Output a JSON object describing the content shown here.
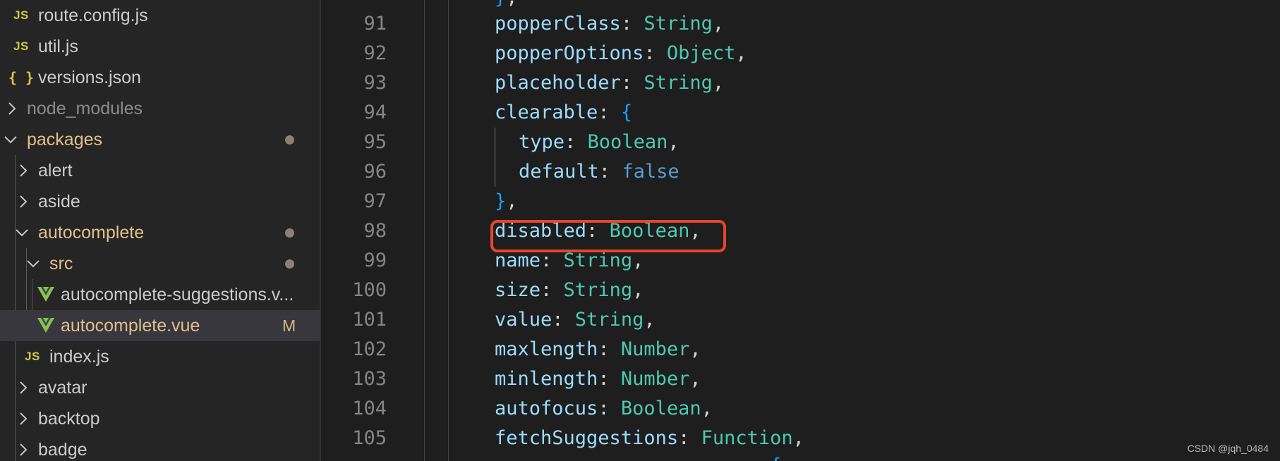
{
  "explorer": {
    "items": [
      {
        "label": "route.config.js",
        "icon": "js-file-icon",
        "icon_text": "JS"
      },
      {
        "label": "util.js",
        "icon": "js-file-icon",
        "icon_text": "JS"
      },
      {
        "label": "versions.json",
        "icon": "json-file-icon",
        "icon_text": "{ }"
      },
      {
        "label": "node_modules",
        "icon": "chevron-right-icon"
      },
      {
        "label": "packages",
        "icon": "chevron-down-icon",
        "modified_dot": true
      },
      {
        "label": "alert",
        "icon": "chevron-right-icon"
      },
      {
        "label": "aside",
        "icon": "chevron-right-icon"
      },
      {
        "label": "autocomplete",
        "icon": "chevron-down-icon",
        "modified_dot": true
      },
      {
        "label": "src",
        "icon": "chevron-down-icon",
        "modified_dot": true
      },
      {
        "label": "autocomplete-suggestions.v...",
        "icon": "vue-file-icon"
      },
      {
        "label": "autocomplete.vue",
        "icon": "vue-file-icon",
        "selected": true,
        "git_status": "M"
      },
      {
        "label": "index.js",
        "icon": "js-file-icon",
        "icon_text": "JS"
      },
      {
        "label": "avatar",
        "icon": "chevron-right-icon"
      },
      {
        "label": "backtop",
        "icon": "chevron-right-icon"
      },
      {
        "label": "badge",
        "icon": "chevron-right-icon"
      }
    ]
  },
  "editor": {
    "lines": [
      {
        "num": "91",
        "key": "popperClass",
        "type": "String",
        "suffix": ","
      },
      {
        "num": "92",
        "key": "popperOptions",
        "type": "Object",
        "suffix": ","
      },
      {
        "num": "93",
        "key": "placeholder",
        "type": "String",
        "suffix": ","
      },
      {
        "num": "94",
        "key": "clearable",
        "open": "{"
      },
      {
        "num": "95",
        "key": "type",
        "type": "Boolean",
        "suffix": ","
      },
      {
        "num": "96",
        "key": "default",
        "literal": "false"
      },
      {
        "num": "97",
        "close": "}",
        "suffix": ","
      },
      {
        "num": "98",
        "key": "disabled",
        "type": "Boolean",
        "suffix": ","
      },
      {
        "num": "99",
        "key": "name",
        "type": "String",
        "suffix": ","
      },
      {
        "num": "100",
        "key": "size",
        "type": "String",
        "suffix": ","
      },
      {
        "num": "101",
        "key": "value",
        "type": "String",
        "suffix": ","
      },
      {
        "num": "102",
        "key": "maxlength",
        "type": "Number",
        "suffix": ","
      },
      {
        "num": "103",
        "key": "minlength",
        "type": "Number",
        "suffix": ","
      },
      {
        "num": "104",
        "key": "autofocus",
        "type": "Boolean",
        "suffix": ","
      },
      {
        "num": "105",
        "key": "fetchSuggestions",
        "type": "Function",
        "suffix": ","
      }
    ],
    "highlighted_line": "98",
    "highlight_color": "#e8452c"
  },
  "watermark": "CSDN @jqh_0484",
  "colors": {
    "property": "#9cdcfe",
    "type": "#4ec9b0",
    "keyword": "#569cd6",
    "bracket": "#179fff",
    "js_icon": "#cbcb41",
    "vue_icon": "#8dc149",
    "modified_text": "#e2c08d"
  }
}
